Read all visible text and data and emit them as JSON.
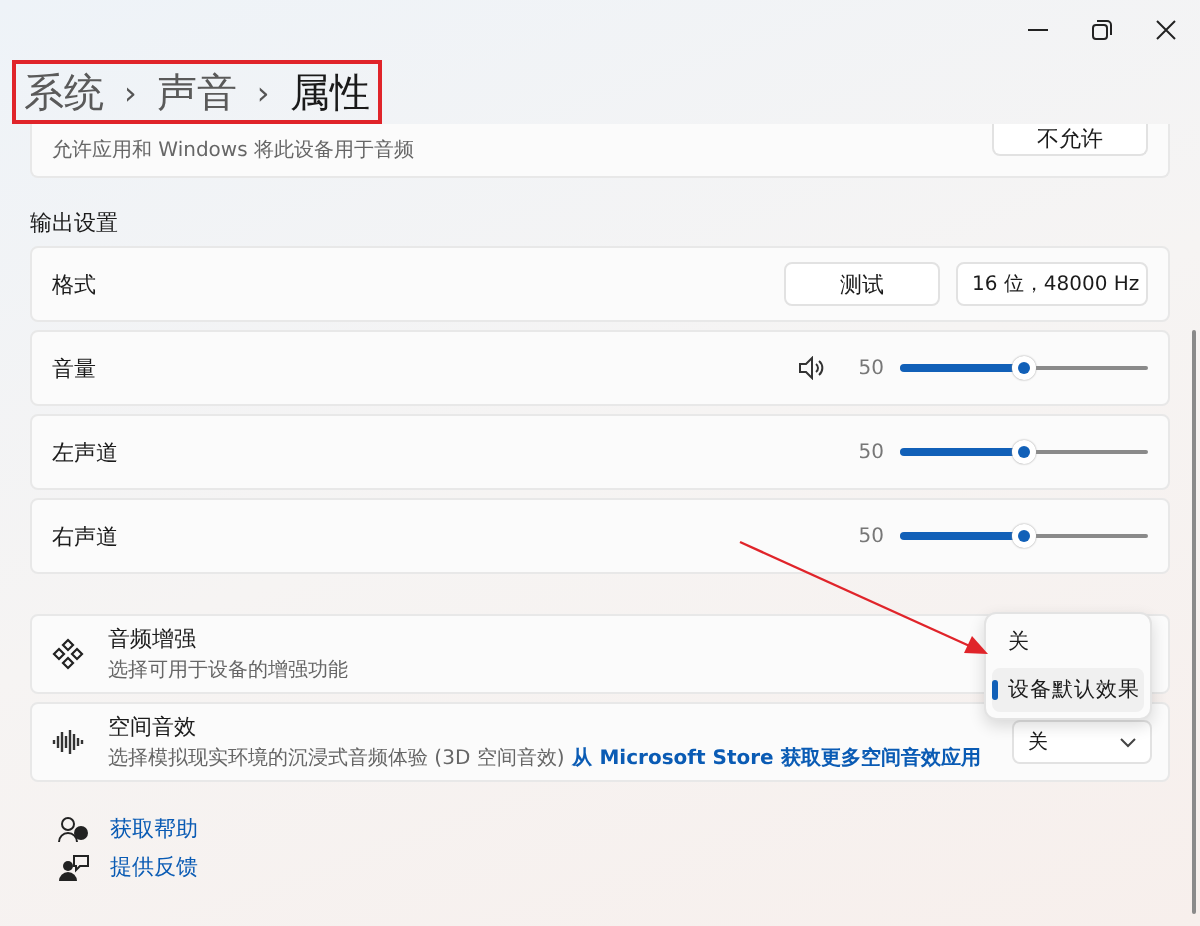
{
  "breadcrumb": {
    "items": [
      "系统",
      "声音",
      "属性"
    ],
    "separator": "›",
    "highlighted": true
  },
  "audio_card": {
    "description": "允许应用和 Windows 将此设备用于音频",
    "button": "不允许"
  },
  "output_section": {
    "heading": "输出设置",
    "format": {
      "label": "格式",
      "test_button": "测试",
      "value": "16 位，48000 Hz"
    },
    "sliders": [
      {
        "kind": "master",
        "label": "音量",
        "reading": "50",
        "level": 0.5
      },
      {
        "kind": "channel",
        "label": "左声道",
        "reading": "50",
        "level": 0.5
      },
      {
        "kind": "channel",
        "label": "右声道",
        "reading": "50",
        "level": 0.5
      }
    ]
  },
  "enhancements": [
    {
      "kind": "menu",
      "title": "音频增强",
      "description": "选择可用于设备的增强功能",
      "menu": [
        {
          "label": "关",
          "selected": false
        },
        {
          "label": "设备默认效果",
          "selected": true
        }
      ]
    },
    {
      "kind": "dropdown",
      "title": "空间音效",
      "description": "选择模拟现实环境的沉浸式音频体验 (3D 空间音效)",
      "link": "从 Microsoft Store 获取更多空间音效应用",
      "value": "关"
    }
  ],
  "links": [
    {
      "kind": "help",
      "label": "获取帮助"
    },
    {
      "kind": "feedback",
      "label": "提供反馈"
    }
  ],
  "annotation_arrow": true
}
